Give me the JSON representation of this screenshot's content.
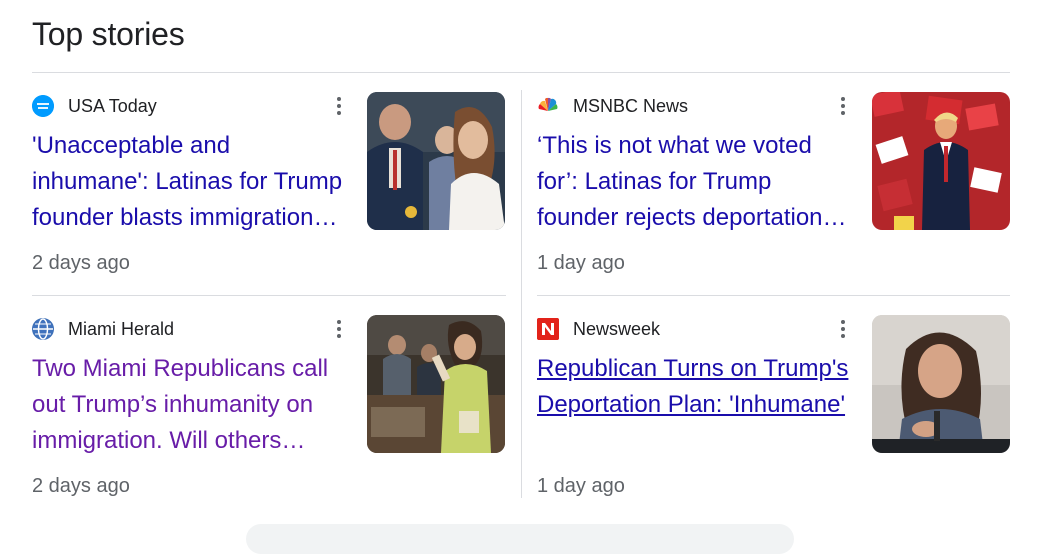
{
  "section": {
    "title": "Top stories"
  },
  "stories": [
    {
      "source": "USA Today",
      "headline": "'Unacceptable and inhumane': Latinas for Trump founder blasts immigration…",
      "time": "2 days ago"
    },
    {
      "source": "MSNBC News",
      "headline": "‘This is not what we voted for’: Latinas for Trump founder rejects deportation…",
      "time": "1 day ago"
    },
    {
      "source": "Miami Herald",
      "headline": "Two Miami Republicans call out Trump’s inhumanity on immigration. Will others…",
      "time": "2 days ago"
    },
    {
      "source": "Newsweek",
      "headline": "Republican Turns on Trump's Deportation Plan: 'Inhumane'",
      "time": "1 day ago"
    }
  ],
  "colors": {
    "link": "#1a0dab",
    "visited_link": "#681da8",
    "meta_text": "#5f6368",
    "divider": "#dadce0"
  }
}
